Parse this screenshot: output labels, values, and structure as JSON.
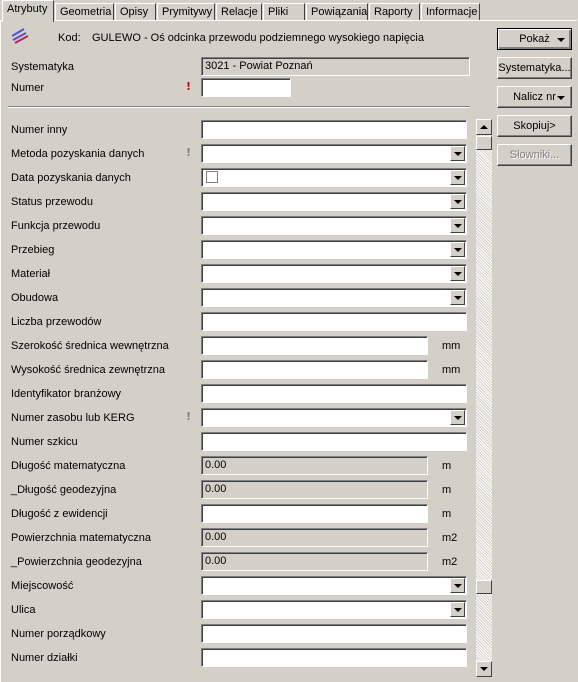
{
  "tabs": [
    "Atrybuty",
    "Geometria",
    "Opisy",
    "Prymitywy",
    "Relacje",
    "Pliki",
    "Powiązania",
    "Raporty",
    "Informacje"
  ],
  "header": {
    "kod_label": "Kod:",
    "kod_value": "GULEWO - Oś odcinka przewodu podziemnego wysokiego napięcia",
    "icon": "power-line-icon"
  },
  "top_fields": {
    "systematyka_label": "Systematyka",
    "systematyka_value": "3021 - Powiat Poznań",
    "numer_label": "Numer",
    "numer_value": ""
  },
  "fields": [
    {
      "label": "Numer inny",
      "type": "text",
      "value": ""
    },
    {
      "label": "Metoda pozyskania danych",
      "type": "select",
      "value": "",
      "warn": "grey"
    },
    {
      "label": "Data pozyskania danych",
      "type": "date",
      "value": ""
    },
    {
      "label": "Status przewodu",
      "type": "select",
      "value": ""
    },
    {
      "label": "Funkcja przewodu",
      "type": "select",
      "value": ""
    },
    {
      "label": "Przebieg",
      "type": "select",
      "value": ""
    },
    {
      "label": "Materiał",
      "type": "select",
      "value": ""
    },
    {
      "label": "Obudowa",
      "type": "select",
      "value": ""
    },
    {
      "label": "Liczba przewodów",
      "type": "text",
      "value": ""
    },
    {
      "label": "Szerokość średnica wewnętrzna",
      "type": "short",
      "value": "",
      "unit": "mm"
    },
    {
      "label": "Wysokość średnica zewnętrzna",
      "type": "short",
      "value": "",
      "unit": "mm"
    },
    {
      "label": "Identyfikator branżowy",
      "type": "text",
      "value": ""
    },
    {
      "label": "Numer zasobu lub KERG",
      "type": "select",
      "value": "",
      "warn": "grey"
    },
    {
      "label": "Numer szkicu",
      "type": "text",
      "value": ""
    },
    {
      "label": "Długość matematyczna",
      "type": "ro",
      "value": "0.00",
      "unit": "m"
    },
    {
      "label": "_Długość geodezyjna",
      "type": "ro",
      "value": "0.00",
      "unit": "m"
    },
    {
      "label": "Długość z ewidencji",
      "type": "short",
      "value": "",
      "unit": "m"
    },
    {
      "label": "Powierzchnia matematyczna",
      "type": "ro",
      "value": "0.00",
      "unit": "m2"
    },
    {
      "label": "_Powierzchnia geodezyjna",
      "type": "ro",
      "value": "0.00",
      "unit": "m2"
    },
    {
      "label": "Miejscowość",
      "type": "select",
      "value": ""
    },
    {
      "label": "Ulica",
      "type": "select",
      "value": ""
    },
    {
      "label": "Numer porządkowy",
      "type": "text",
      "value": ""
    },
    {
      "label": "Numer działki",
      "type": "text",
      "value": ""
    }
  ],
  "buttons": {
    "pokaz": "Pokaż",
    "systematyka": "Systematyka...",
    "nalicz": "Nalicz nr",
    "skopiuj": "Skopiuj>",
    "slowniki": "Słowniki..."
  },
  "warn_glyph": "!",
  "colors": {
    "background": "#d4d0c8",
    "warn_red": "#d00000",
    "warn_grey": "#808080",
    "icon": "#5a4fcf"
  }
}
